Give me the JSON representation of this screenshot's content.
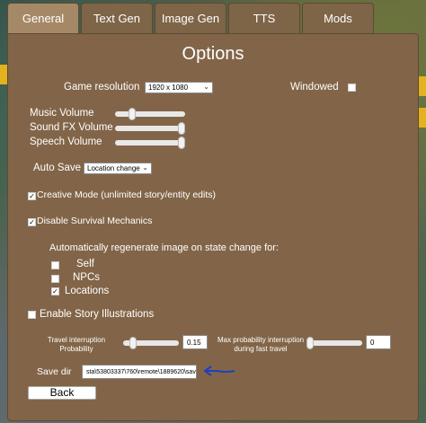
{
  "tabs": [
    "General",
    "Text Gen",
    "Image Gen",
    "TTS",
    "Mods"
  ],
  "title": "Options",
  "game_resolution": {
    "label": "Game resolution",
    "value": "1920 x 1080"
  },
  "windowed": {
    "label": "Windowed",
    "checked": false
  },
  "volumes": [
    {
      "label": "Music Volume",
      "value": 0.25
    },
    {
      "label": "Sound FX Volume",
      "value": 1.0
    },
    {
      "label": "Speech Volume",
      "value": 1.0
    }
  ],
  "auto_save": {
    "label": "Auto Save",
    "value": "Location change"
  },
  "creative_mode": {
    "label": "Creative Mode (unlimited story/entity edits)",
    "checked": true
  },
  "disable_survival": {
    "label": "Disable Survival Mechanics",
    "checked": true
  },
  "regen": {
    "heading": "Automatically regenerate image on state change for:",
    "items": [
      {
        "label": "Self",
        "checked": false
      },
      {
        "label": "NPCs",
        "checked": false
      },
      {
        "label": "Locations",
        "checked": true
      }
    ]
  },
  "story_illustrations": {
    "label": "Enable Story Illustrations",
    "checked": false
  },
  "travel_interruption": {
    "label": "Travel interruption Probability",
    "value": "0.15"
  },
  "max_interruption": {
    "label": "Max probability interruption during fast travel",
    "value": "0"
  },
  "save_dir": {
    "label": "Save dir",
    "value": "sta\\53803337\\760\\remote\\1889620\\save\\"
  },
  "back_button": "Back",
  "annotation_color": "#1f3fbf"
}
